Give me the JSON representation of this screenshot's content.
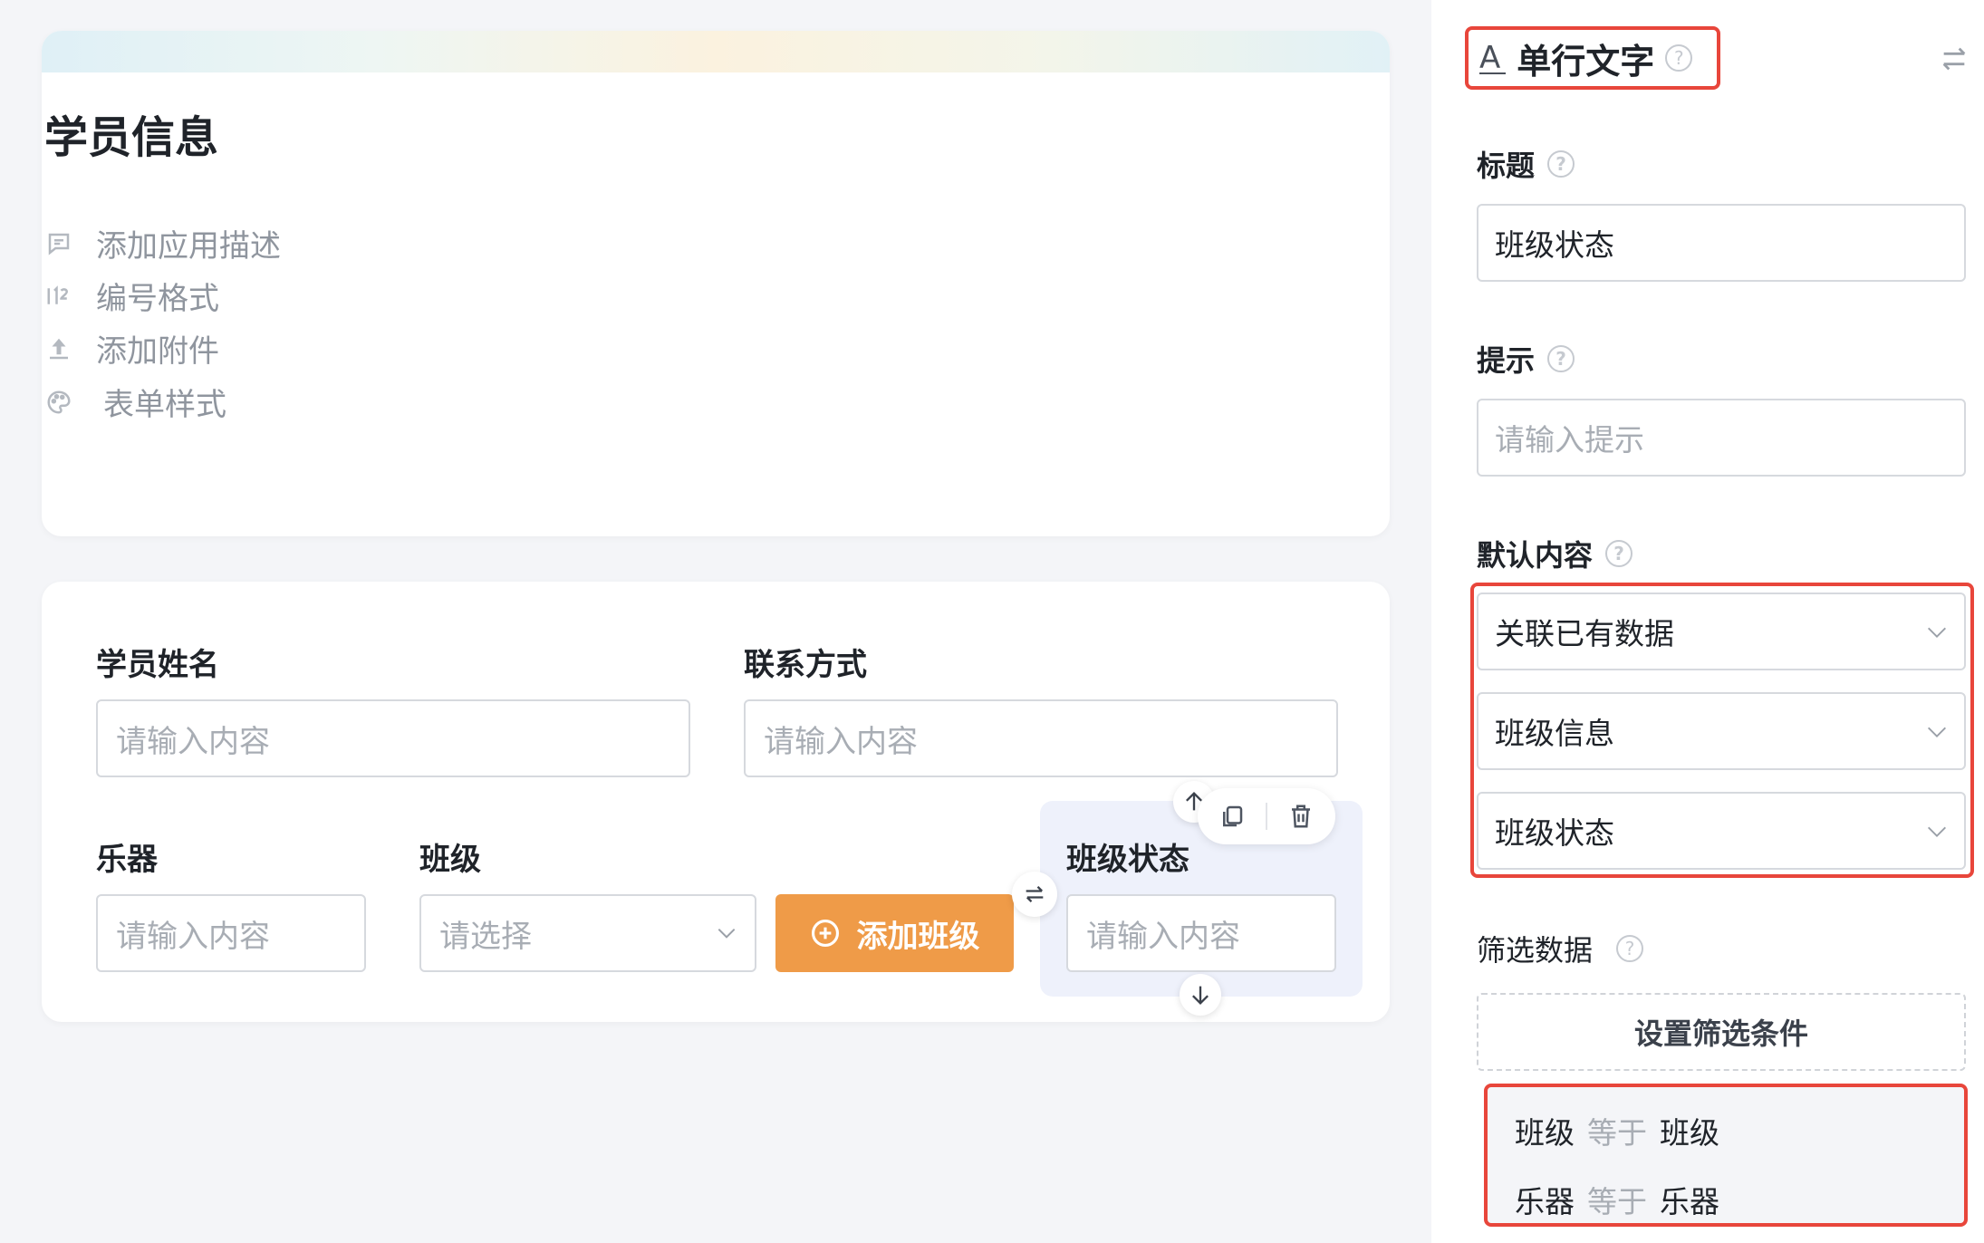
{
  "form": {
    "title": "学员信息",
    "meta": [
      {
        "label": "添加应用描述",
        "icon": "comment-icon"
      },
      {
        "label": "编号格式",
        "icon": "number-format-icon"
      },
      {
        "label": "添加附件",
        "icon": "upload-icon"
      },
      {
        "label": "表单样式",
        "icon": "palette-icon"
      }
    ],
    "fields": {
      "student_name": {
        "label": "学员姓名",
        "placeholder": "请输入内容"
      },
      "contact": {
        "label": "联系方式",
        "placeholder": "请输入内容"
      },
      "instrument": {
        "label": "乐器",
        "placeholder": "请输入内容"
      },
      "class": {
        "label": "班级",
        "placeholder": "请选择"
      },
      "class_status": {
        "label": "班级状态",
        "placeholder": "请输入内容"
      }
    },
    "add_class_button": "添加班级"
  },
  "panel": {
    "component_type": "单行文字",
    "component_glyph": "A",
    "help_glyph": "?",
    "title": {
      "label": "标题",
      "value": "班级状态"
    },
    "hint": {
      "label": "提示",
      "placeholder": "请输入提示"
    },
    "default_content": {
      "label": "默认内容",
      "selects": [
        "关联已有数据",
        "班级信息",
        "班级状态"
      ]
    },
    "filter": {
      "label": "筛选数据",
      "button": "设置筛选条件",
      "conditions": [
        {
          "field": "班级",
          "op": "等于",
          "value": "班级"
        },
        {
          "field": "乐器",
          "op": "等于",
          "value": "乐器"
        }
      ]
    }
  },
  "colors": {
    "accent_orange": "#ef9b48",
    "highlight_red": "#e8463b",
    "selected_field_bg": "#eef1fb"
  }
}
